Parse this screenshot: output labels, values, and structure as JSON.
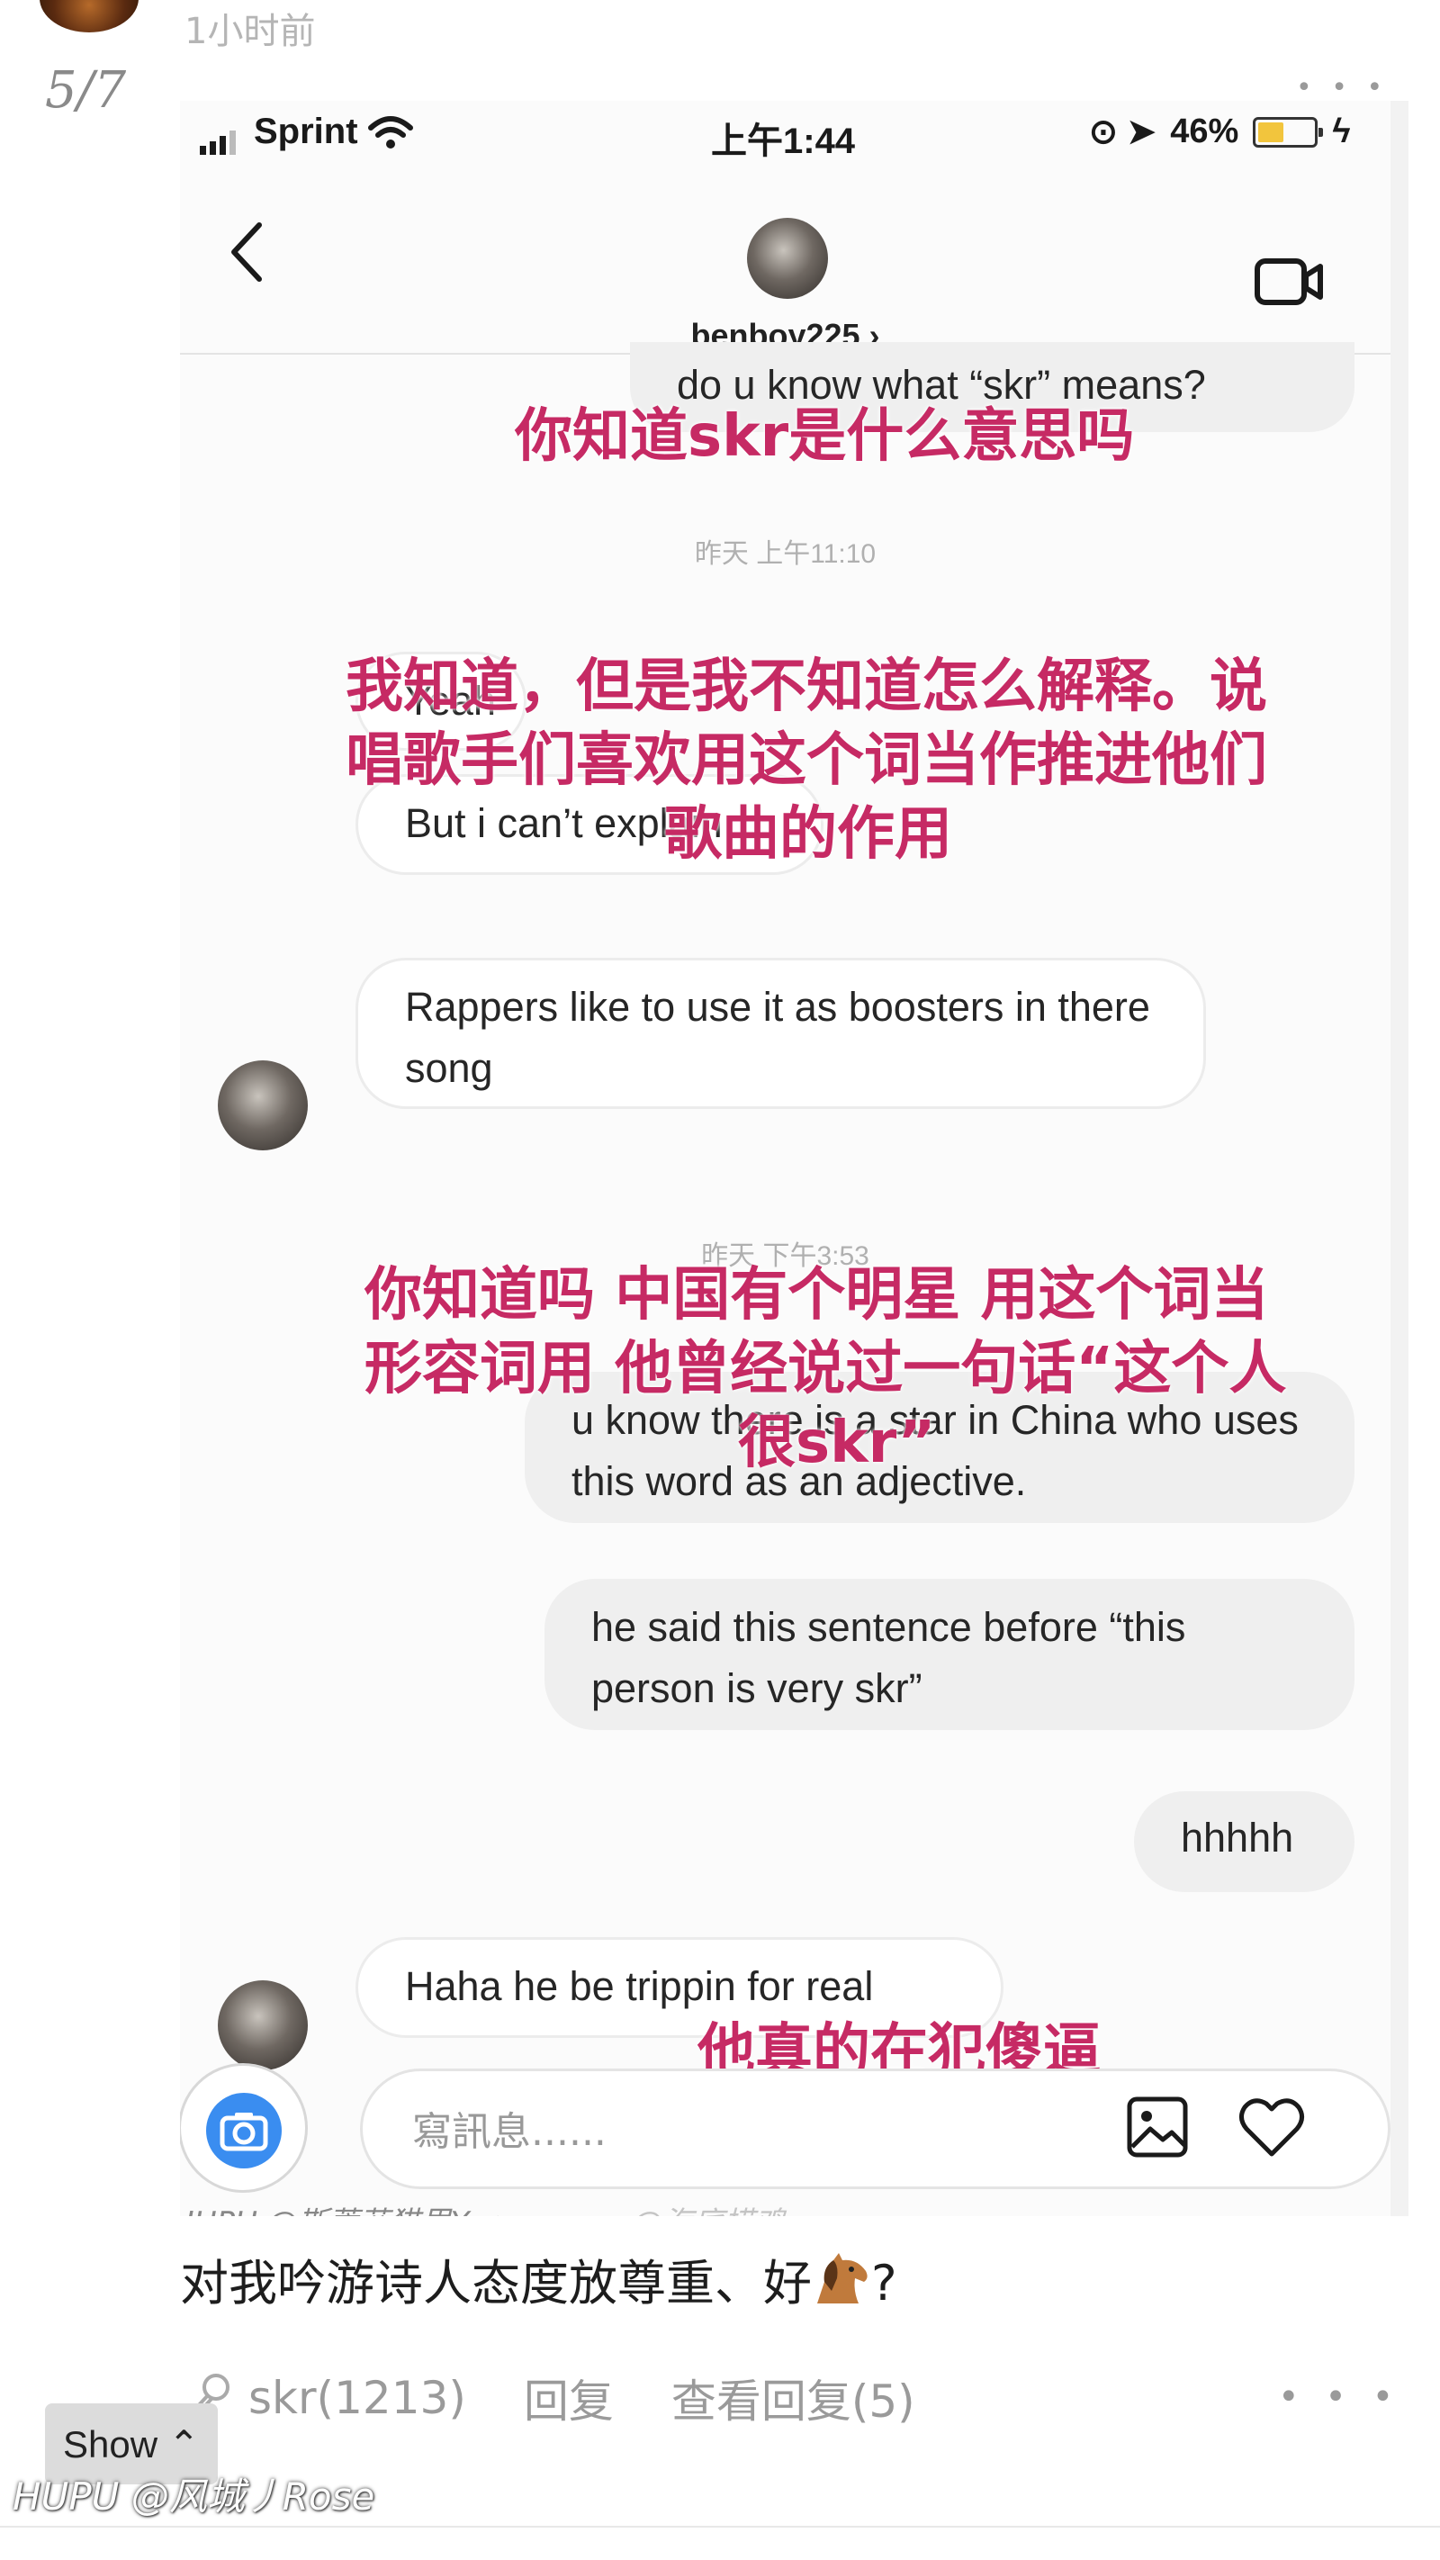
{
  "post": {
    "time_ago": "1小时前",
    "image_counter": "5/7",
    "dots": "• • •",
    "caption": "对我吟游诗人态度放尊重、好",
    "caption_end": "?",
    "actions": {
      "like_label": "skr(1213)",
      "reply_label": "回复",
      "view_replies_label": "查看回复(5)"
    },
    "more": "• • •",
    "show_label": "Show ⌃",
    "watermark": "HUPU @风城丿Rose"
  },
  "screenshot": {
    "status_bar": {
      "carrier": "Sprint",
      "time": "上午1:44",
      "battery": "46%",
      "battery_level": 0.46
    },
    "header": {
      "username": "benboy225 ›"
    },
    "messages": [
      {
        "id": "m1",
        "text": "do u know what “skr” means?"
      },
      {
        "id": "ts1",
        "text": "昨天 上午11:10"
      },
      {
        "id": "m2",
        "text": "Yeah"
      },
      {
        "id": "m3",
        "text": "But i can’t explain"
      },
      {
        "id": "m4",
        "text": "Rappers like to use it as boosters in there song"
      },
      {
        "id": "ts2",
        "text": "昨天 下午3:53"
      },
      {
        "id": "m5",
        "text": "u know there is a star in China who uses this word as an adjective."
      },
      {
        "id": "m6",
        "text": "he said this sentence before “this person is very skr”"
      },
      {
        "id": "m7",
        "text": "hhhhh"
      },
      {
        "id": "m8",
        "text": "Haha he be trippin for real"
      }
    ],
    "overlays": {
      "o1": "你知道skr是什么意思吗",
      "o2_l1": "我知道，但是我不知道怎么解释。说",
      "o2_l2": "唱歌手们喜欢用这个词当作推进他们",
      "o2_l3": "歌曲的作用",
      "o3_l1": "你知道吗 中国有个明星 用这个词当",
      "o3_l2": "形容词用 他曾经说过一句话“这个人",
      "o3_l3": "很skr”",
      "o4": "他真的在犯傻逼"
    },
    "composer_placeholder": "寫訊息......",
    "watermarks": {
      "left": "HUPU @斯蒂芬猫里Yang",
      "right": "@海底捞鸡"
    }
  },
  "colors": {
    "overlay_pink": "#c62a64",
    "accent_blue": "#3a8df0"
  }
}
